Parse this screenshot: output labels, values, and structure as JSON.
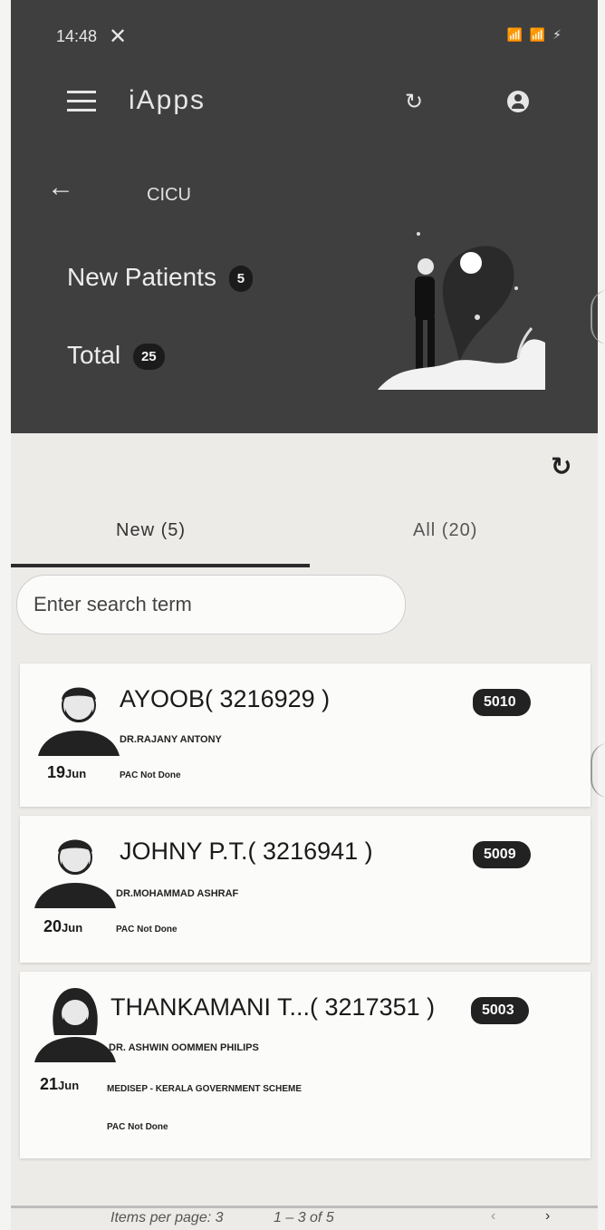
{
  "status_bar": {
    "time": "14:48",
    "close_glyph": "✕",
    "icons": "📶 📶 ⚡"
  },
  "app_bar": {
    "title": "iApps",
    "menu_icon": "menu-icon",
    "refresh_icon": "refresh-icon",
    "account_icon": "account-icon"
  },
  "unit": {
    "back_icon": "arrow-left-icon",
    "name": "CICU"
  },
  "summary": {
    "new_label": "New Patients",
    "new_count": "5",
    "total_label": "Total",
    "total_count": "25"
  },
  "tabs": [
    {
      "label": "New (5)",
      "active": true
    },
    {
      "label": "All (20)",
      "active": false
    }
  ],
  "search": {
    "placeholder": "Enter search term"
  },
  "patients": [
    {
      "name": "AYOOB( 3216929 )",
      "doctor": "DR.RAJANY ANTONY",
      "day": "19",
      "month": "Jun",
      "scheme": "",
      "status": "PAC Not Done",
      "badge": "5010",
      "gender": "male"
    },
    {
      "name": "JOHNY P.T.( 3216941 )",
      "doctor": "DR.MOHAMMAD ASHRAF",
      "day": "20",
      "month": "Jun",
      "scheme": "",
      "status": "PAC Not Done",
      "badge": "5009",
      "gender": "male"
    },
    {
      "name": "THANKAMANI T...( 3217351 )",
      "doctor": "DR. ASHWIN OOMMEN PHILIPS",
      "day": "21",
      "month": "Jun",
      "scheme": "MEDISEP - KERALA GOVERNMENT SCHEME",
      "status": "PAC Not Done",
      "badge": "5003",
      "gender": "female"
    }
  ],
  "paginator": {
    "items_per_page": "Items per page: 3",
    "range": "1 – 3 of 5",
    "prev": "‹",
    "next": "›"
  },
  "colors": {
    "header_bg": "#3f3f3f",
    "badge_bg": "#222222",
    "page_bg": "#ecebe8"
  }
}
